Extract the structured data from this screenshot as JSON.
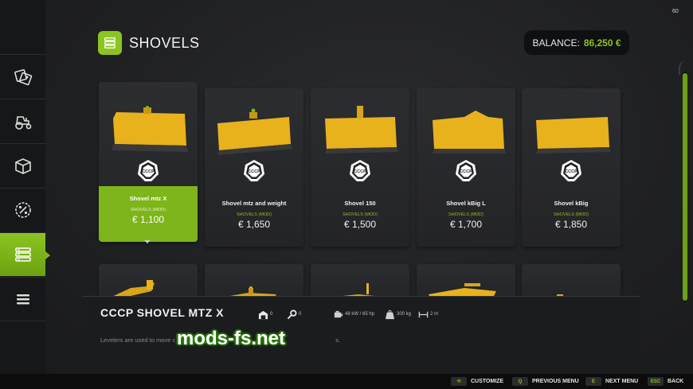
{
  "page": {
    "title": "SHOVELS",
    "fps": "60"
  },
  "balance": {
    "label": "BALANCE:",
    "value": "86,250 €"
  },
  "colors": {
    "accent": "#8cc421",
    "accent_dark": "#6da112",
    "item_yellow": "#e8b21c"
  },
  "sidebar": {
    "items": [
      {
        "icon": "tag-icon"
      },
      {
        "icon": "tractor-icon"
      },
      {
        "icon": "box-icon"
      },
      {
        "icon": "percent-badge-icon"
      },
      {
        "icon": "list-icon",
        "active": true
      },
      {
        "icon": "menu-icon"
      }
    ]
  },
  "shop_items": [
    {
      "name": "Shovel mtz X",
      "category": "SHOVELS (MOD)",
      "price": "€ 1,100",
      "selected": true,
      "brand_logo": "СССР"
    },
    {
      "name": "Shovel mtz and weight",
      "category": "SHOVELS (MOD)",
      "price": "€ 1,650",
      "brand_logo": "СССР"
    },
    {
      "name": "Shovel 150",
      "category": "SHOVELS (MOD)",
      "price": "€ 1,500",
      "brand_logo": "СССР"
    },
    {
      "name": "Shovel kBig L",
      "category": "SHOVELS (MOD)",
      "price": "€ 1,700",
      "brand_logo": "СССР"
    },
    {
      "name": "Shovel kBig",
      "category": "SHOVELS (MOD)",
      "price": "€ 1,850",
      "brand_logo": "СССР"
    }
  ],
  "detail": {
    "title": "CCCP SHOVEL MTZ X",
    "garage_count": "0",
    "key_count": "0",
    "power": "48 kW / 65 hp",
    "weight": "300 kg",
    "width": "2 m",
    "description": "Levelers are used to move c",
    "description_end": "s."
  },
  "watermark": "mods-fs.net",
  "footer": {
    "hints": [
      {
        "key": "⟲",
        "label": "CUSTOMIZE"
      },
      {
        "key": "Q",
        "label": "PREVIOUS MENU"
      },
      {
        "key": "E",
        "label": "NEXT MENU"
      },
      {
        "key": "ESC",
        "label": "BACK"
      }
    ]
  }
}
